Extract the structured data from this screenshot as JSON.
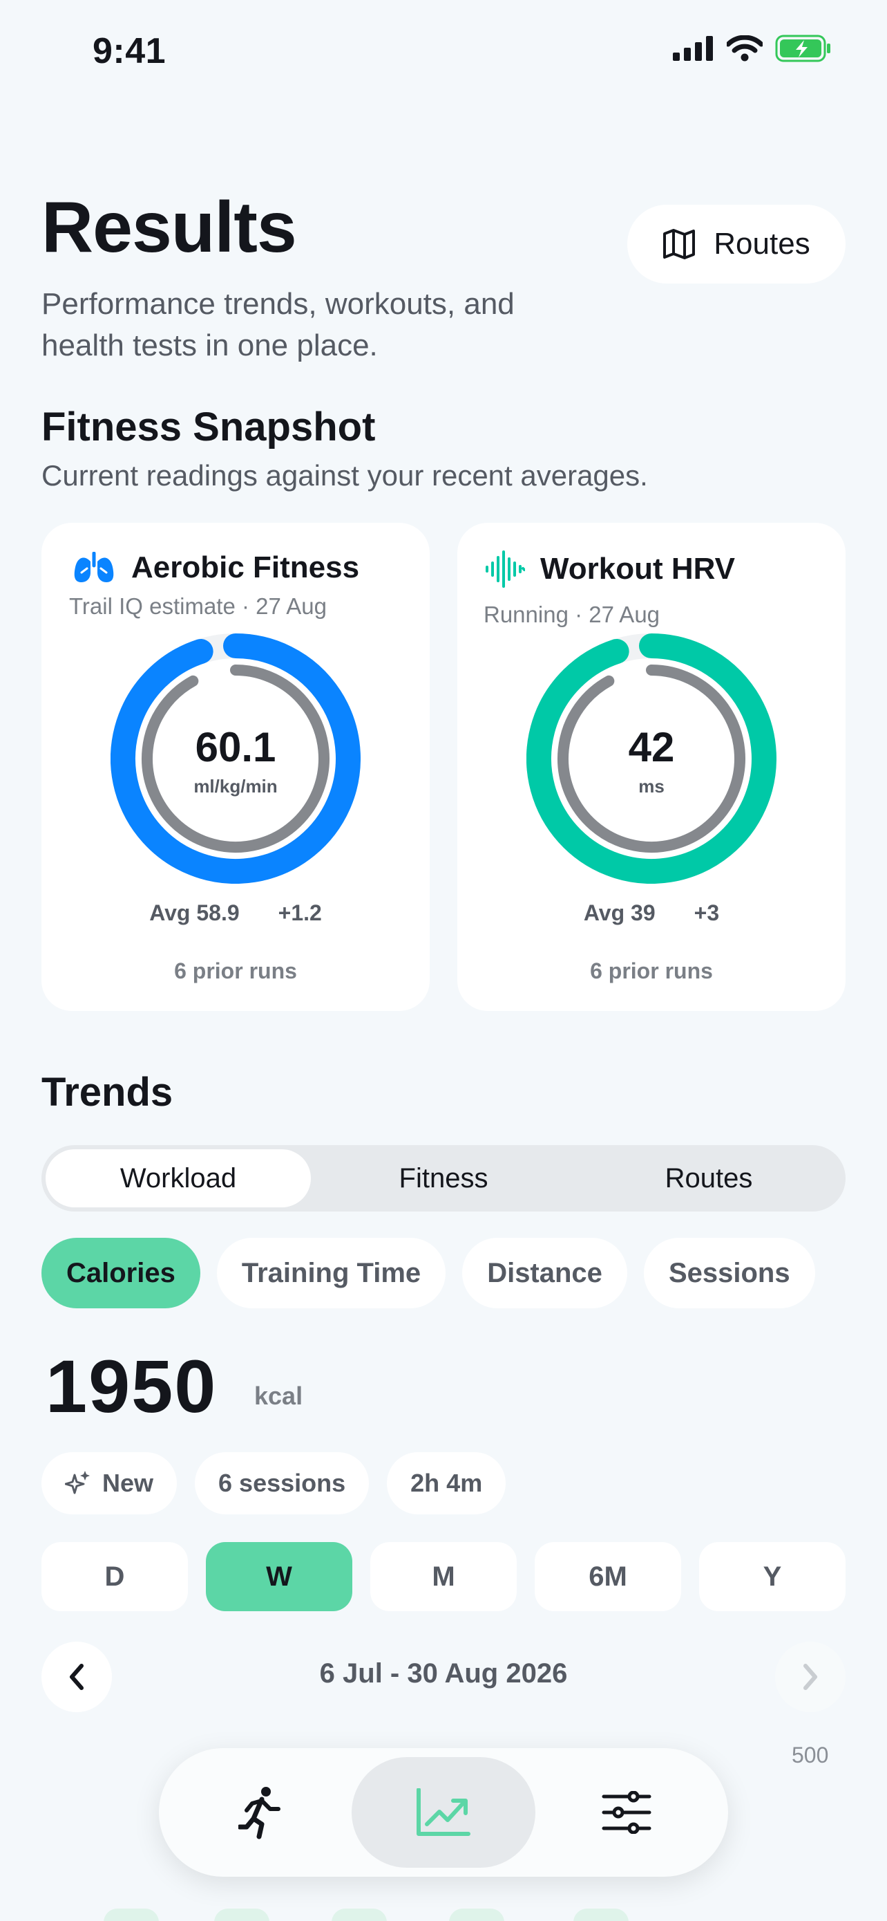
{
  "status_bar": {
    "time": "9:41"
  },
  "header": {
    "title": "Results",
    "subtitle": "Performance trends, workouts, and health tests in one place.",
    "routes_button": "Routes"
  },
  "snapshot": {
    "title": "Fitness Snapshot",
    "description": "Current readings against your recent averages.",
    "cards": [
      {
        "title": "Aerobic Fitness",
        "subtitle": "Trail IQ estimate · 27 Aug",
        "value": "60.1",
        "unit": "ml/kg/min",
        "average": "Avg 58.9",
        "delta": "+1.2",
        "footer": "6 prior runs",
        "ring_fraction": 0.95,
        "inner_fraction": 0.92,
        "color": "#0A84FF",
        "icon": "lungs-icon"
      },
      {
        "title": "Workout HRV",
        "subtitle": "Running · 27 Aug",
        "value": "42",
        "unit": "ms",
        "average": "Avg 39",
        "delta": "+3",
        "footer": "6 prior runs",
        "ring_fraction": 0.95,
        "inner_fraction": 0.92,
        "color": "#00C9A7",
        "icon": "waveform-icon"
      }
    ]
  },
  "trends": {
    "title": "Trends",
    "segments": [
      "Workload",
      "Fitness",
      "Routes"
    ],
    "active_segment": "Workload",
    "metrics": [
      "Calories",
      "Training Time",
      "Distance",
      "Sessions"
    ],
    "active_metric": "Calories",
    "value": "1950",
    "unit": "kcal",
    "pills": [
      "New",
      "6 sessions",
      "2h 4m"
    ],
    "ranges": [
      "D",
      "W",
      "M",
      "6M",
      "Y"
    ],
    "active_range": "W",
    "date_range": "6 Jul - 30 Aug 2026",
    "axis_top_label": "500"
  },
  "tabbar": {
    "tabs": [
      "workout-tab",
      "results-tab",
      "settings-tab"
    ],
    "active": "results-tab",
    "accent": "#5CD6A6"
  },
  "colors": {
    "background": "#F4F8FB",
    "accent": "#5CD6A6",
    "battery": "#34C759"
  }
}
